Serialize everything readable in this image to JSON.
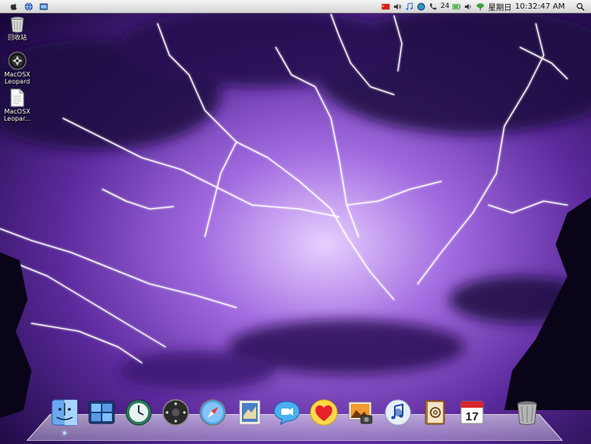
{
  "menubar": {
    "tray_badge": "24",
    "clock_day": "星期日",
    "clock_time": "10:32:47 AM"
  },
  "desktop": {
    "icons": [
      {
        "label": "回收站",
        "icon": "trash-icon"
      },
      {
        "label": "MacOSX Leopard ...",
        "icon": "leopard-disc-icon"
      },
      {
        "label": "MacOSX Leopar...",
        "icon": "document-icon"
      }
    ]
  },
  "dock": {
    "items": [
      {
        "icon": "finder-icon"
      },
      {
        "icon": "spaces-icon"
      },
      {
        "icon": "time-machine-icon"
      },
      {
        "icon": "front-row-icon"
      },
      {
        "icon": "safari-icon"
      },
      {
        "icon": "mail-stamp-icon"
      },
      {
        "icon": "ichat-icon"
      },
      {
        "icon": "heart-icon"
      },
      {
        "icon": "iphoto-icon"
      },
      {
        "icon": "itunes-icon"
      },
      {
        "icon": "address-book-icon"
      },
      {
        "icon": "ical-icon",
        "date": "17"
      },
      {
        "icon": "trash-icon"
      }
    ]
  },
  "colors": {
    "sky_dark": "#160638",
    "sky_mid": "#5b2a9c",
    "sky_light": "#d7b9ff",
    "lightning": "#ffffff",
    "menubar": "#e6e6e6"
  }
}
